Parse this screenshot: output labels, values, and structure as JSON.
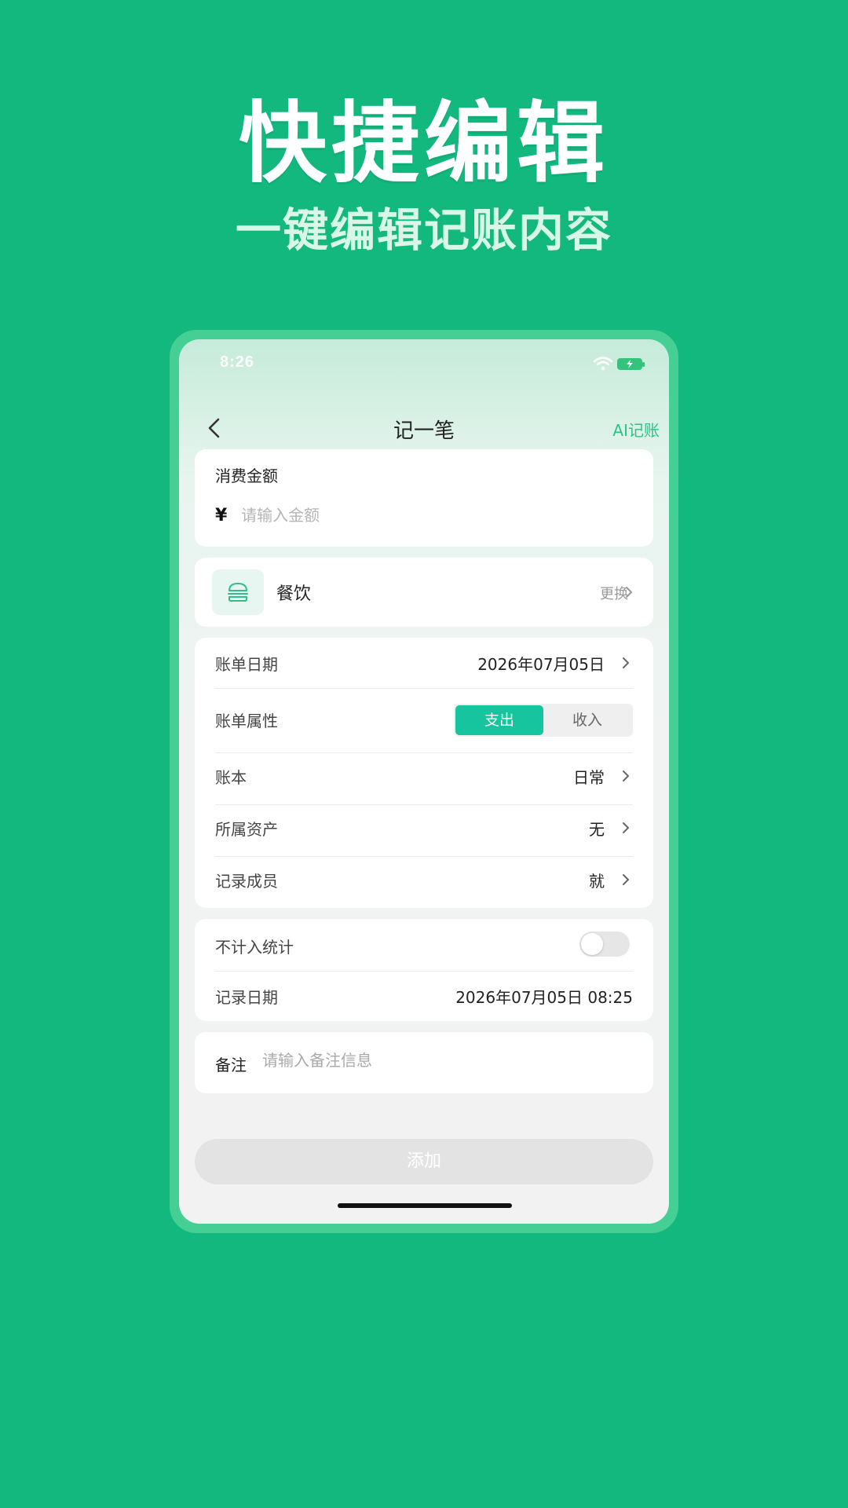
{
  "promo": {
    "title": "快捷编辑",
    "subtitle": "一键编辑记账内容"
  },
  "status_bar": {
    "time": "8:26",
    "icons": [
      "wifi-icon",
      "battery-charging-icon"
    ]
  },
  "nav": {
    "title": "记一笔",
    "ai_label": "AI记账",
    "back_icon": "chevron-left-icon"
  },
  "amount": {
    "label": "消费金额",
    "currency_symbol": "¥",
    "placeholder": "请输入金额",
    "value": ""
  },
  "category": {
    "name": "餐饮",
    "change_label": "更换",
    "icon": "burger-icon"
  },
  "details": {
    "bill_date": {
      "label": "账单日期",
      "value": "2026年07月05日"
    },
    "bill_type": {
      "label": "账单属性",
      "options": [
        "支出",
        "收入"
      ],
      "selected": "支出"
    },
    "ledger": {
      "label": "账本",
      "value": "日常"
    },
    "asset": {
      "label": "所属资产",
      "value": "无"
    },
    "member": {
      "label": "记录成员",
      "value": "就"
    }
  },
  "stats": {
    "exclude": {
      "label": "不计入统计",
      "enabled": false
    },
    "record_date": {
      "label": "记录日期",
      "value": "2026年07月05日 08:25"
    }
  },
  "note": {
    "label": "备注",
    "placeholder": "请输入备注信息",
    "value": ""
  },
  "submit": {
    "label": "添加"
  },
  "colors": {
    "background": "#13b87e",
    "frame": "#45cf94",
    "accent": "#16c59e",
    "ai_text": "#2fbf8a",
    "button_disabled": "#e3e3e3"
  }
}
